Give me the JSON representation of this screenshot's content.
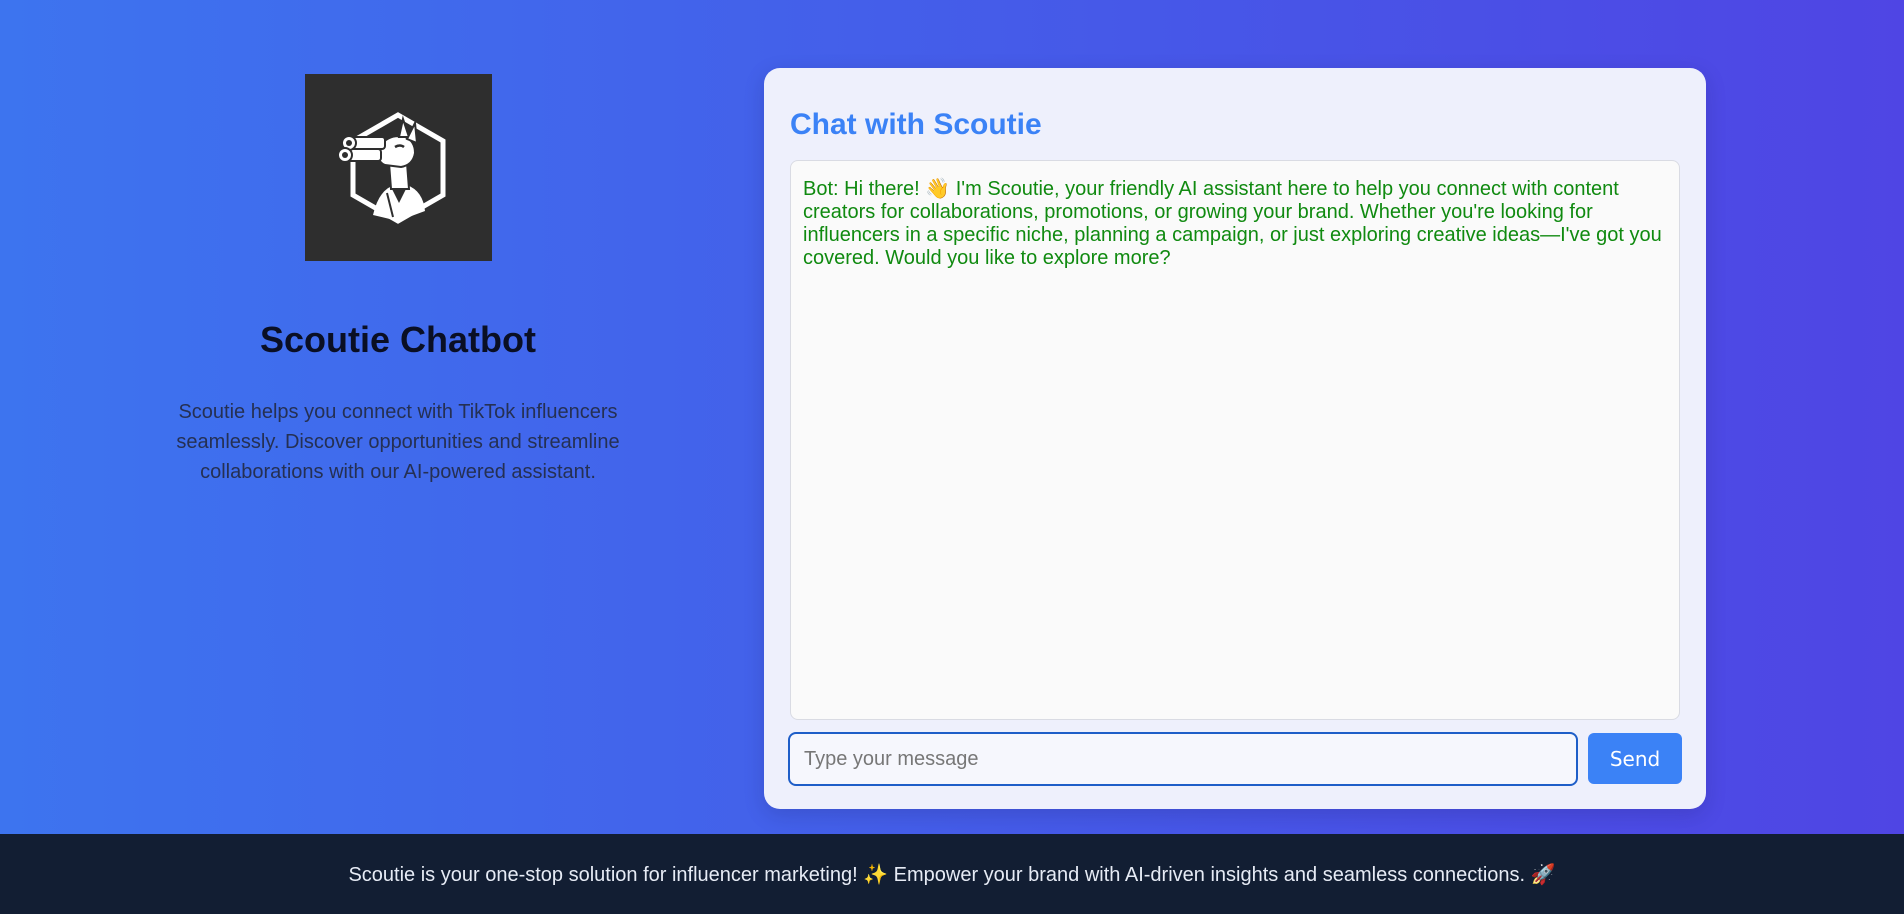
{
  "brand": {
    "logo_icon": "llama-binoculars-logo",
    "title": "Scoutie Chatbot",
    "description": "Scoutie helps you connect with TikTok influencers seamlessly. Discover opportunities and streamline collaborations with our AI-powered assistant."
  },
  "chat": {
    "title": "Chat with Scoutie",
    "messages": [
      {
        "sender": "Bot",
        "text": "Bot: Hi there! 👋 I'm Scoutie, your friendly AI assistant here to help you connect with content creators for collaborations, promotions, or growing your brand. Whether you're looking for influencers in a specific niche, planning a campaign, or just exploring creative ideas—I've got you covered. Would you like to explore more?"
      }
    ],
    "input_value": "",
    "input_placeholder": "Type your message",
    "send_label": "Send"
  },
  "footer": {
    "text": "Scoutie is your one-stop solution for influencer marketing! ✨ Empower your brand with AI-driven insights and seamless connections. 🚀"
  },
  "colors": {
    "accent": "#3b82f6",
    "bot_text": "#108a10",
    "footer_bg": "#121e33",
    "logo_bg": "#2e2e2e"
  }
}
